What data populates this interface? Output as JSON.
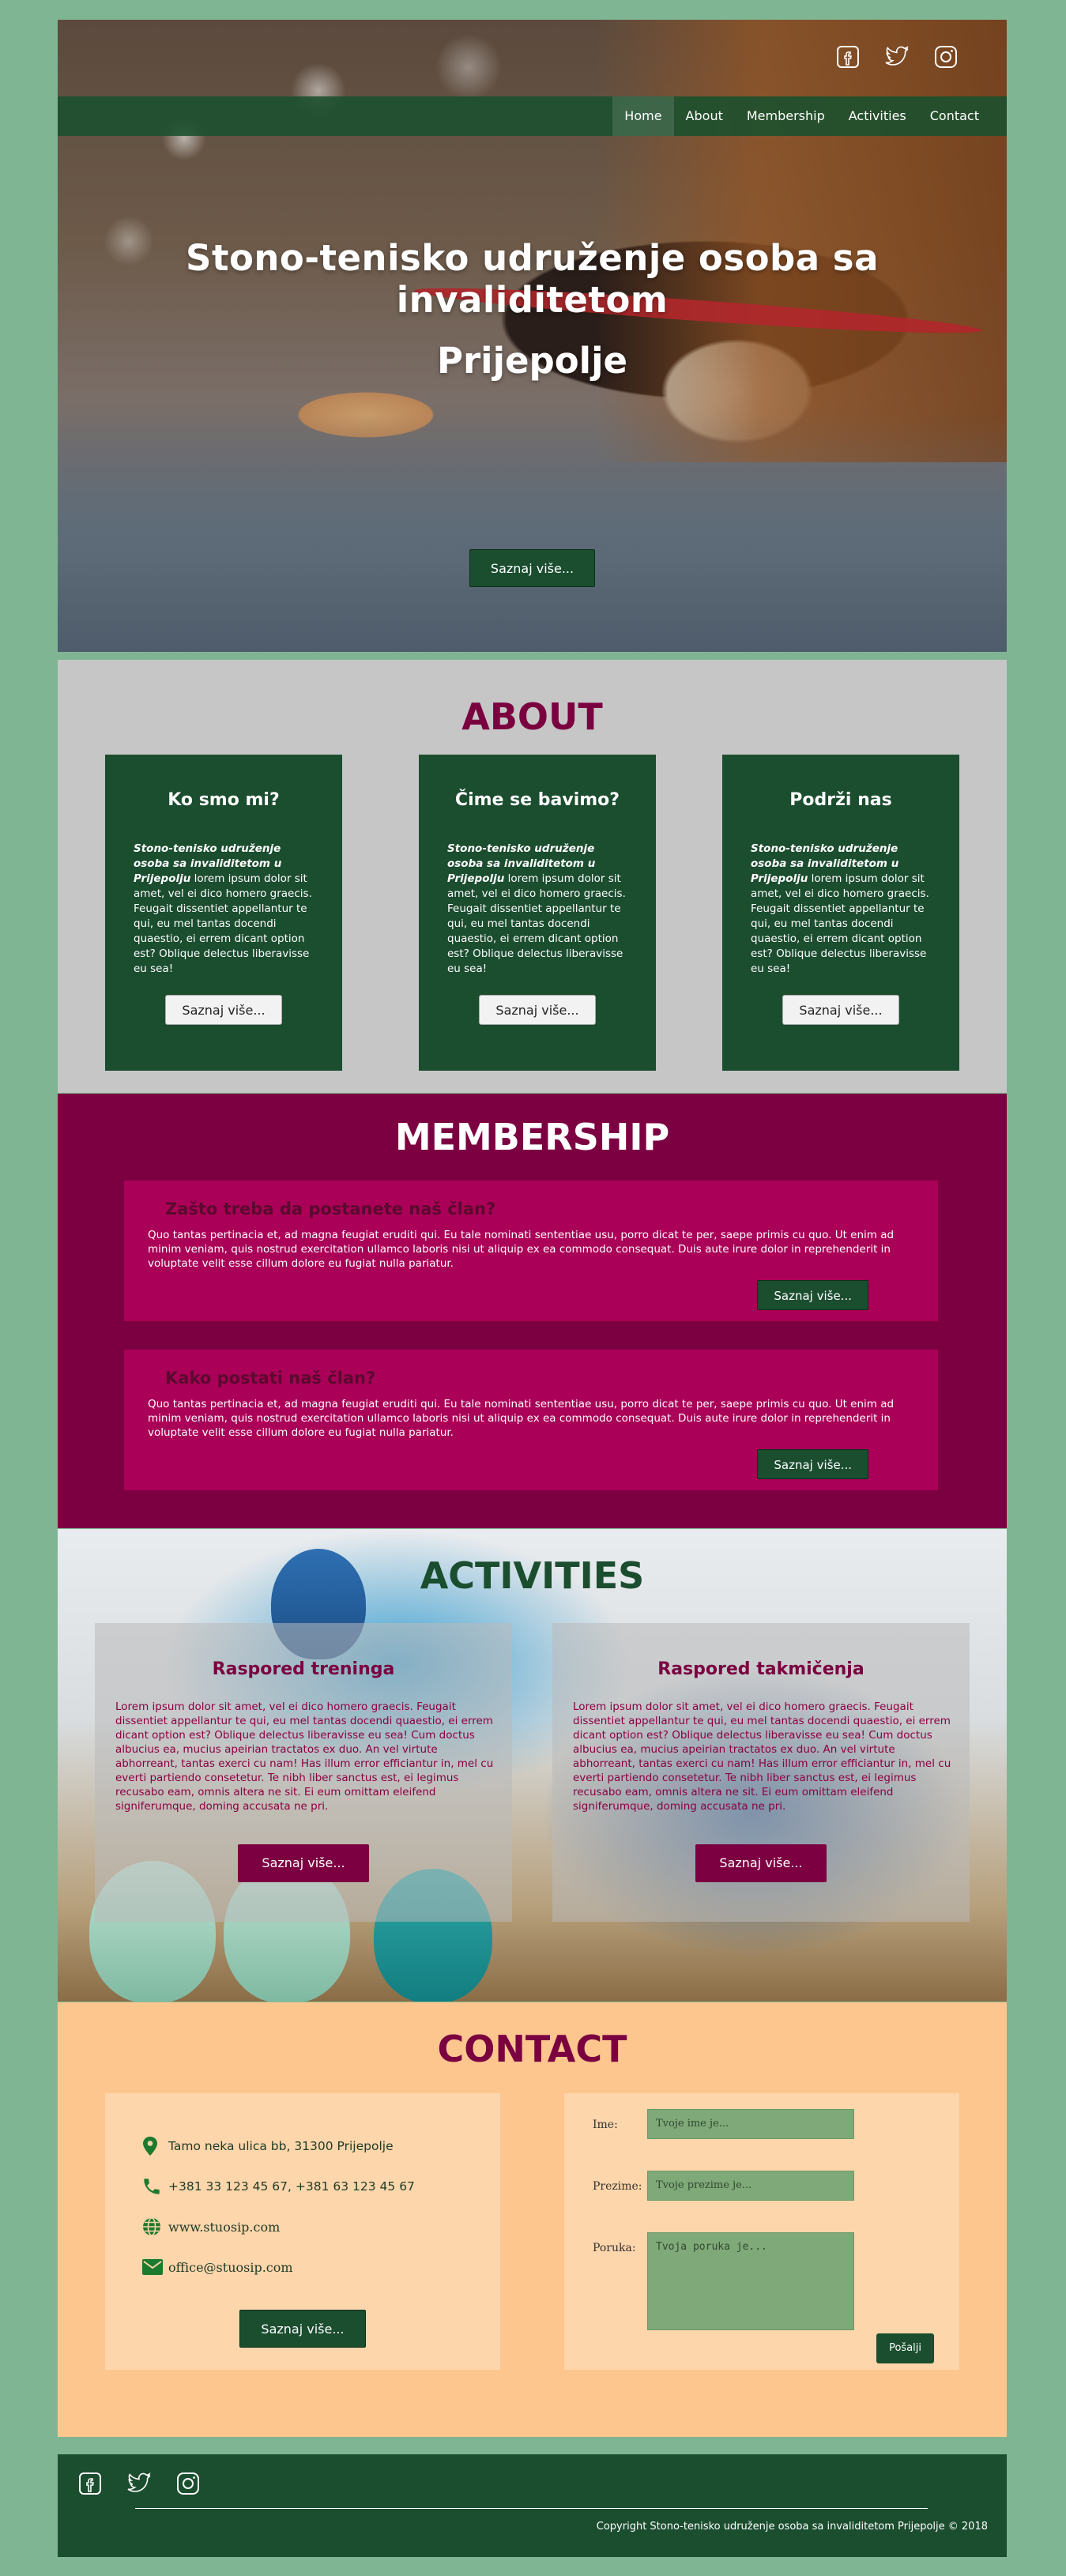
{
  "social": {
    "facebook": "facebook-icon",
    "twitter": "twitter-icon",
    "instagram": "instagram-icon"
  },
  "nav": [
    "Home",
    "About",
    "Membership",
    "Activities",
    "Contact"
  ],
  "hero": {
    "title": "Stono-tenisko udruženje osoba sa invaliditetom",
    "subtitle": "Prijepolje",
    "cta": "Saznaj više..."
  },
  "about": {
    "title": "ABOUT",
    "cards": [
      {
        "heading": "Ko smo mi?",
        "lead": "Stono-tenisko udruženje osoba sa invaliditetom u Prijepolju",
        "body": " lorem ipsum dolor sit amet, vel ei dico homero graecis. Feugait dissentiet appellantur te qui, eu mel tantas docendi quaestio, ei errem dicant option est? Oblique delectus liberavisse eu sea!",
        "button": "Saznaj više..."
      },
      {
        "heading": "Čime se bavimo?",
        "lead": "Stono-tenisko udruženje osoba sa invaliditetom u Prijepolju",
        "body": " lorem ipsum dolor sit amet, vel ei dico homero graecis. Feugait dissentiet appellantur te qui, eu mel tantas docendi quaestio, ei errem dicant option est? Oblique delectus liberavisse eu sea!",
        "button": "Saznaj više..."
      },
      {
        "heading": "Podrži nas",
        "lead": "Stono-tenisko udruženje osoba sa invaliditetom u Prijepolju",
        "body": " lorem ipsum dolor sit amet, vel ei dico homero graecis. Feugait dissentiet appellantur te qui, eu mel tantas docendi quaestio, ei errem dicant option est? Oblique delectus liberavisse eu sea!",
        "button": "Saznaj više..."
      }
    ]
  },
  "membership": {
    "title": "MEMBERSHIP",
    "boxes": [
      {
        "heading": "Zašto treba da postanete naš član?",
        "body": "Quo tantas pertinacia et, ad magna feugiat eruditi qui. Eu tale nominati sententiae usu, porro dicat te per, saepe primis cu quo. Ut enim ad minim veniam, quis nostrud exercitation ullamco laboris nisi ut aliquip ex ea commodo consequat. Duis aute irure dolor in reprehenderit in voluptate velit esse cillum dolore eu fugiat nulla pariatur.",
        "button": "Saznaj više..."
      },
      {
        "heading": "Kako postati naš član?",
        "body": "Quo tantas pertinacia et, ad magna feugiat eruditi qui. Eu tale nominati sententiae usu, porro dicat te per, saepe primis cu quo. Ut enim ad minim veniam, quis nostrud exercitation ullamco laboris nisi ut aliquip ex ea commodo consequat. Duis aute irure dolor in reprehenderit in voluptate velit esse cillum dolore eu fugiat nulla pariatur.",
        "button": "Saznaj više..."
      }
    ]
  },
  "activities": {
    "title": "ACTIVITIES",
    "cards": [
      {
        "heading": "Raspored treninga",
        "body": "Lorem ipsum dolor sit amet, vel ei dico homero graecis. Feugait dissentiet appellantur te qui, eu mel tantas docendi quaestio, ei errem dicant option est? Oblique delectus liberavisse eu sea! Cum doctus albucius ea, mucius apeirian tractatos ex duo. An vel virtute abhorreant, tantas exerci cu nam! Has illum error efficiantur in, mel cu everti partiendo consetetur. Te nibh liber sanctus est, ei legimus recusabo eam, omnis altera ne sit. Ei eum omittam eleifend signiferumque, doming accusata ne pri.",
        "button": "Saznaj više..."
      },
      {
        "heading": "Raspored takmičenja",
        "body": "Lorem ipsum dolor sit amet, vel ei dico homero graecis. Feugait dissentiet appellantur te qui, eu mel tantas docendi quaestio, ei errem dicant option est? Oblique delectus liberavisse eu sea! Cum doctus albucius ea, mucius apeirian tractatos ex duo. An vel virtute abhorreant, tantas exerci cu nam! Has illum error efficiantur in, mel cu everti partiendo consetetur. Te nibh liber sanctus est, ei legimus recusabo eam, omnis altera ne sit. Ei eum omittam eleifend signiferumque, doming accusata ne pri.",
        "button": "Saznaj više..."
      }
    ]
  },
  "contact": {
    "title": "CONTACT",
    "address": "Tamo neka ulica bb, 31300 Prijepolje",
    "phone": "+381 33 123 45 67, +381 63 123 45 67",
    "web": "www.stuosip.com",
    "email": "office@stuosip.com",
    "button": "Saznaj više...",
    "form": {
      "name_label": "Ime:",
      "name_placeholder": "Tvoje ime je...",
      "surname_label": "Prezime:",
      "surname_placeholder": "Tvoje prezime je...",
      "message_label": "Poruka:",
      "message_placeholder": "Tvoja poruka je...",
      "send": "Pošalji"
    }
  },
  "footer": {
    "copyright": "Copyright Stono-tenisko udruženje osoba sa invaliditetom Prijepolje © 2018"
  },
  "colors": {
    "green": "#1b4d2f",
    "maroon": "#7c0041",
    "magenta": "#aa0057",
    "peach": "#fdc68f",
    "grey": "#c6c6c6",
    "bg": "#7fb593"
  }
}
